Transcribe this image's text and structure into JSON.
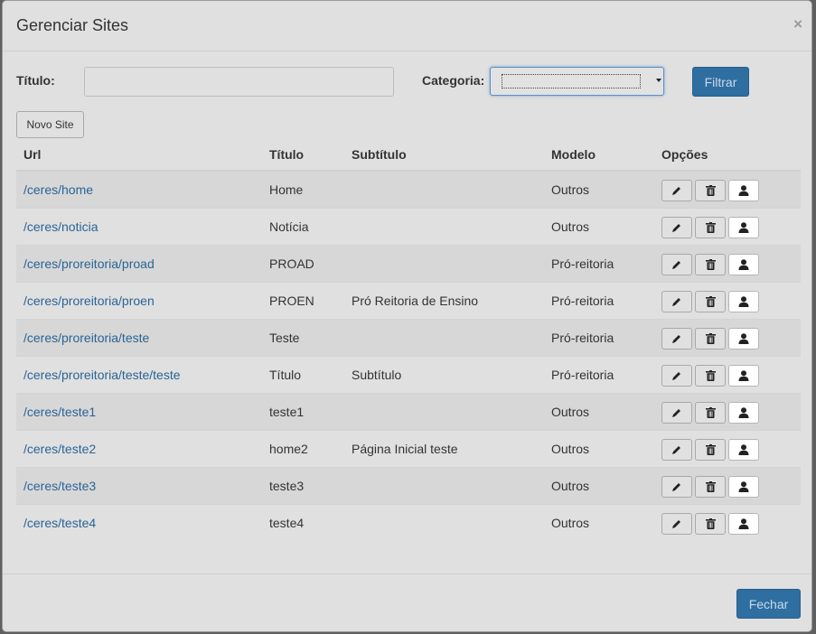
{
  "modal": {
    "title": "Gerenciar Sites",
    "close_symbol": "×",
    "close_icon": "close-icon"
  },
  "filters": {
    "titulo_label": "Título:",
    "titulo_value": "",
    "categoria_label": "Categoria:",
    "categoria_value": "",
    "filtrar_label": "Filtrar"
  },
  "toolbar": {
    "novo_site_label": "Novo Site"
  },
  "table": {
    "headers": [
      "Url",
      "Título",
      "Subtítulo",
      "Modelo",
      "Opções"
    ],
    "rows": [
      {
        "url": "/ceres/home",
        "titulo": "Home",
        "subtitulo": "",
        "modelo": "Outros"
      },
      {
        "url": "/ceres/noticia",
        "titulo": "Notícia",
        "subtitulo": "",
        "modelo": "Outros"
      },
      {
        "url": "/ceres/proreitoria/proad",
        "titulo": "PROAD",
        "subtitulo": "",
        "modelo": "Pró-reitoria"
      },
      {
        "url": "/ceres/proreitoria/proen",
        "titulo": "PROEN",
        "subtitulo": "Pró Reitoria de Ensino",
        "modelo": "Pró-reitoria"
      },
      {
        "url": "/ceres/proreitoria/teste",
        "titulo": "Teste",
        "subtitulo": "",
        "modelo": "Pró-reitoria"
      },
      {
        "url": "/ceres/proreitoria/teste/teste",
        "titulo": "Título",
        "subtitulo": "Subtítulo",
        "modelo": "Pró-reitoria"
      },
      {
        "url": "/ceres/teste1",
        "titulo": "teste1",
        "subtitulo": "",
        "modelo": "Outros"
      },
      {
        "url": "/ceres/teste2",
        "titulo": "home2",
        "subtitulo": "Página Inicial teste",
        "modelo": "Outros"
      },
      {
        "url": "/ceres/teste3",
        "titulo": "teste3",
        "subtitulo": "",
        "modelo": "Outros"
      },
      {
        "url": "/ceres/teste4",
        "titulo": "teste4",
        "subtitulo": "",
        "modelo": "Outros"
      }
    ],
    "option_icons": [
      "pencil-icon",
      "trash-icon",
      "user-icon"
    ]
  },
  "footer": {
    "fechar_label": "Fechar"
  },
  "colors": {
    "primary": "#2e6ea0",
    "link": "#2a6496",
    "overlay": "#606060",
    "highlight": "#ffffff"
  }
}
